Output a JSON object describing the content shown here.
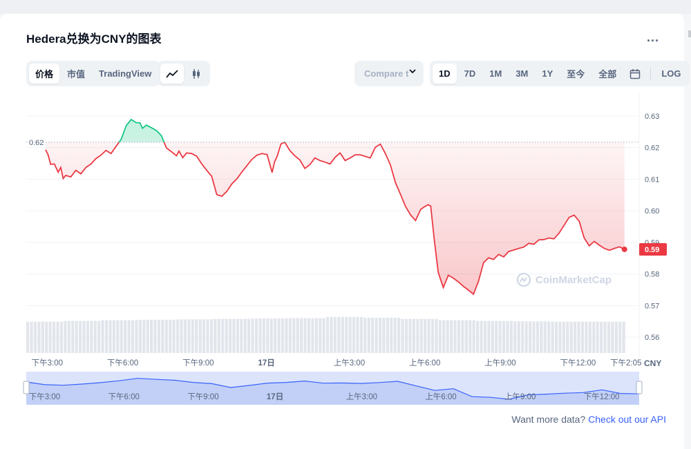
{
  "title": "Hedera兑换为CNY的图表",
  "more_label": "...",
  "tabs": [
    {
      "label": "价格",
      "active": true
    },
    {
      "label": "市值",
      "active": false
    },
    {
      "label": "TradingView",
      "active": false
    }
  ],
  "chart_types": [
    {
      "icon": "line-chart-icon",
      "active": true
    },
    {
      "icon": "candlestick-icon",
      "active": false
    }
  ],
  "compare": {
    "label": "Compare t"
  },
  "ranges": [
    {
      "label": "1D",
      "active": true
    },
    {
      "label": "7D",
      "active": false
    },
    {
      "label": "1M",
      "active": false
    },
    {
      "label": "3M",
      "active": false
    },
    {
      "label": "1Y",
      "active": false
    },
    {
      "label": "至今",
      "active": false
    },
    {
      "label": "全部",
      "active": false
    }
  ],
  "calendar_icon": "calendar-icon",
  "log_label": "LOG",
  "watermark": "CoinMarketCap",
  "footer": {
    "text": "Want more data? ",
    "link": "Check out our API"
  },
  "colors": {
    "up": "#16c784",
    "down": "#ea3943",
    "accent": "#3861fb",
    "navigator": "#dbe4fb"
  },
  "chart_data": {
    "type": "line",
    "ylim": [
      0.555,
      0.635
    ],
    "yticks": [
      "0.63",
      "0.62",
      "0.61",
      "0.60",
      "0.59",
      "0.58",
      "0.57",
      "0.56"
    ],
    "ytick_values": [
      0.63,
      0.62,
      0.61,
      0.6,
      0.59,
      0.58,
      0.57,
      0.56
    ],
    "reference": {
      "label": "0.62",
      "value": 0.6217
    },
    "current": {
      "label": "0.59",
      "value": 0.5878
    },
    "currency_label": "CNY",
    "xticks": [
      "下午3:00",
      "下午6:00",
      "下午9:00",
      "17日",
      "上午3:00",
      "上午6:00",
      "上午9:00",
      "下午12:00",
      "下午2:05"
    ],
    "xtick_hours": [
      0.1,
      3.1,
      6.1,
      9.1,
      12.1,
      15.1,
      18.1,
      21.1,
      23.2
    ],
    "nav_xticks": [
      "下午3:00",
      "下午6:00",
      "下午9:00",
      "17日",
      "上午3:00",
      "上午6:00",
      "上午9:00",
      "下午12:00"
    ],
    "x_hours": [
      0,
      0.1,
      0.2,
      0.35,
      0.5,
      0.6,
      0.7,
      0.8,
      1.0,
      1.2,
      1.4,
      1.6,
      1.8,
      2.0,
      2.2,
      2.4,
      2.6,
      2.8,
      3.0,
      3.2,
      3.4,
      3.6,
      3.75,
      3.85,
      4.0,
      4.2,
      4.4,
      4.6,
      4.8,
      5.0,
      5.2,
      5.3,
      5.45,
      5.6,
      5.8,
      6.0,
      6.2,
      6.4,
      6.6,
      6.8,
      7.0,
      7.2,
      7.4,
      7.6,
      7.8,
      8.0,
      8.2,
      8.4,
      8.6,
      8.8,
      9.0,
      9.1,
      9.2,
      9.35,
      9.5,
      9.7,
      9.9,
      10.1,
      10.3,
      10.5,
      10.7,
      10.9,
      11.1,
      11.3,
      11.5,
      11.7,
      11.9,
      12.1,
      12.3,
      12.5,
      12.7,
      12.9,
      13.1,
      13.3,
      13.5,
      13.7,
      13.9,
      14.1,
      14.3,
      14.5,
      14.7,
      14.9,
      15.0,
      15.1,
      15.2,
      15.3,
      15.45,
      15.6,
      15.8,
      16.0,
      16.2,
      16.4,
      16.6,
      16.8,
      17.0,
      17.2,
      17.4,
      17.6,
      17.8,
      18.0,
      18.2,
      18.4,
      18.6,
      18.8,
      19.0,
      19.2,
      19.4,
      19.6,
      19.8,
      20.0,
      20.2,
      20.4,
      20.6,
      20.8,
      21.0,
      21.2,
      21.4,
      21.6,
      21.8,
      22.0,
      22.2,
      22.4,
      22.6,
      22.8,
      23.0
    ],
    "y_values": [
      0.6193,
      0.6177,
      0.6147,
      0.6148,
      0.6122,
      0.6137,
      0.6102,
      0.6112,
      0.6107,
      0.6128,
      0.6117,
      0.6137,
      0.6148,
      0.6165,
      0.6176,
      0.6191,
      0.6181,
      0.6204,
      0.6226,
      0.6269,
      0.6289,
      0.6279,
      0.6278,
      0.6261,
      0.6271,
      0.6263,
      0.6254,
      0.6238,
      0.6199,
      0.6187,
      0.6174,
      0.6189,
      0.6168,
      0.6183,
      0.6181,
      0.6173,
      0.6149,
      0.6128,
      0.6109,
      0.6051,
      0.6046,
      0.6061,
      0.6085,
      0.6101,
      0.6123,
      0.6143,
      0.6163,
      0.6176,
      0.6181,
      0.6178,
      0.6121,
      0.6155,
      0.6172,
      0.6211,
      0.6217,
      0.6191,
      0.6174,
      0.6161,
      0.6134,
      0.6146,
      0.6167,
      0.6159,
      0.6154,
      0.6148,
      0.6169,
      0.6183,
      0.6159,
      0.6167,
      0.6177,
      0.6177,
      0.6172,
      0.6167,
      0.6201,
      0.6211,
      0.6181,
      0.6145,
      0.6089,
      0.6052,
      0.6014,
      0.5987,
      0.5969,
      0.6004,
      0.601,
      0.6015,
      0.6019,
      0.6015,
      0.5904,
      0.5805,
      0.5757,
      0.5796,
      0.5787,
      0.5775,
      0.5761,
      0.5749,
      0.5736,
      0.5777,
      0.5836,
      0.5851,
      0.5846,
      0.5862,
      0.5854,
      0.5871,
      0.5876,
      0.5881,
      0.5885,
      0.5897,
      0.5894,
      0.5908,
      0.5909,
      0.5914,
      0.5911,
      0.5929,
      0.5954,
      0.5979,
      0.5986,
      0.5967,
      0.5914,
      0.5889,
      0.5903,
      0.5891,
      0.5881,
      0.5875,
      0.5881,
      0.5886,
      0.5878
    ],
    "nav_values": [
      0.6193,
      0.6122,
      0.6107,
      0.6137,
      0.6176,
      0.6226,
      0.6289,
      0.6261,
      0.6238,
      0.6181,
      0.6149,
      0.6046,
      0.6101,
      0.6163,
      0.6181,
      0.6217,
      0.6161,
      0.6167,
      0.6154,
      0.6177,
      0.6211,
      0.6089,
      0.5969,
      0.6015,
      0.5805,
      0.5787,
      0.5736,
      0.5851,
      0.5871,
      0.5897,
      0.5914,
      0.5986,
      0.5889,
      0.5878
    ],
    "volume_relative": [
      0.78,
      0.8,
      0.82,
      0.83,
      0.84,
      0.85,
      0.86,
      0.87,
      0.9,
      0.88,
      0.85,
      0.82,
      0.8,
      0.79,
      0.78,
      0.78
    ]
  }
}
